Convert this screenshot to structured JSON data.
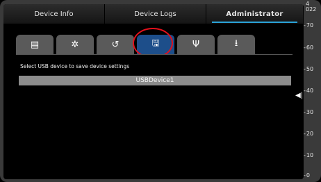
{
  "top_tabs": [
    {
      "label": "Device Info",
      "active": false
    },
    {
      "label": "Device Logs",
      "active": false
    },
    {
      "label": "Administrator",
      "active": true
    }
  ],
  "icon_tabs": [
    {
      "icon": "list-icon",
      "glyph": "▤",
      "active": false
    },
    {
      "icon": "gear-icon",
      "glyph": "✲",
      "active": false
    },
    {
      "icon": "restore-icon",
      "glyph": "↺",
      "active": false
    },
    {
      "icon": "save-icon",
      "glyph": "🖫",
      "active": true
    },
    {
      "icon": "usb-icon",
      "glyph": "Ψ",
      "active": false
    },
    {
      "icon": "download-icon",
      "glyph": "⭳",
      "active": false
    }
  ],
  "content": {
    "instruction": "Select USB device to save device settings",
    "usb_devices": [
      "USBDevice1"
    ]
  },
  "side": {
    "collapse_glyph": "◀|"
  },
  "scale": {
    "top_label_line1": "4",
    "top_label_line2": "022",
    "ticks": [
      "70",
      "60",
      "50",
      "40",
      "30",
      "20",
      "10",
      "0"
    ]
  },
  "colors": {
    "accent": "#2aa3d8",
    "active_icon_tab": "#1d4e8a",
    "highlight": "#e3101b",
    "usb_row": "#8c8c8c"
  }
}
